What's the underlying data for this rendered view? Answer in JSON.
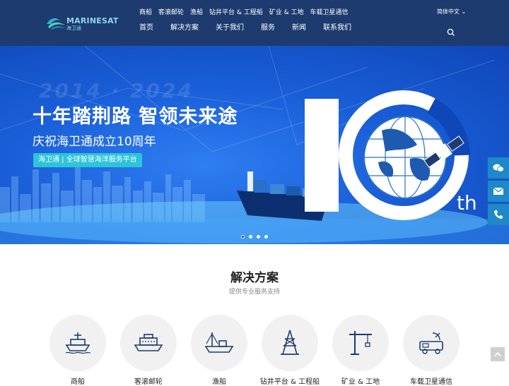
{
  "header": {
    "logo_text": "MARINESAT",
    "logo_sub": "海卫通",
    "top_links": [
      "商船",
      "客滚邮轮",
      "渔船",
      "钻井平台 & 工程船",
      "矿业 & 工地",
      "车载卫星通信"
    ],
    "nav": [
      "首页",
      "解决方案",
      "关于我们",
      "服务",
      "新闻",
      "联系我们"
    ],
    "language": "简体中文",
    "search_icon": "search-icon"
  },
  "banner": {
    "watermark": "2014 · 2024",
    "title": "十年踏荆路  智领未来途",
    "subtitle": "庆祝海卫通成立10周年",
    "tag": "海卫通 | 全球智慧海洋服务平台",
    "big_number": "10",
    "suffix": "th",
    "slides": 4,
    "active_slide": 1,
    "colors": {
      "bg": "#1a5fd8",
      "tag": "#2dc4d8"
    }
  },
  "side_float": [
    "wechat-icon",
    "mail-icon",
    "phone-icon"
  ],
  "solutions": {
    "title": "解决方案",
    "subtitle": "提供专业服务支持",
    "items": [
      {
        "label": "商船",
        "icon": "cargo-ship-icon"
      },
      {
        "label": "客滚邮轮",
        "icon": "cruise-ship-icon"
      },
      {
        "label": "渔船",
        "icon": "fishing-boat-icon"
      },
      {
        "label": "钻井平台 & 工程船",
        "icon": "drilling-rig-icon"
      },
      {
        "label": "矿业 & 工地",
        "icon": "crane-icon"
      },
      {
        "label": "车载卫星通信",
        "icon": "vehicle-satellite-icon"
      }
    ]
  }
}
